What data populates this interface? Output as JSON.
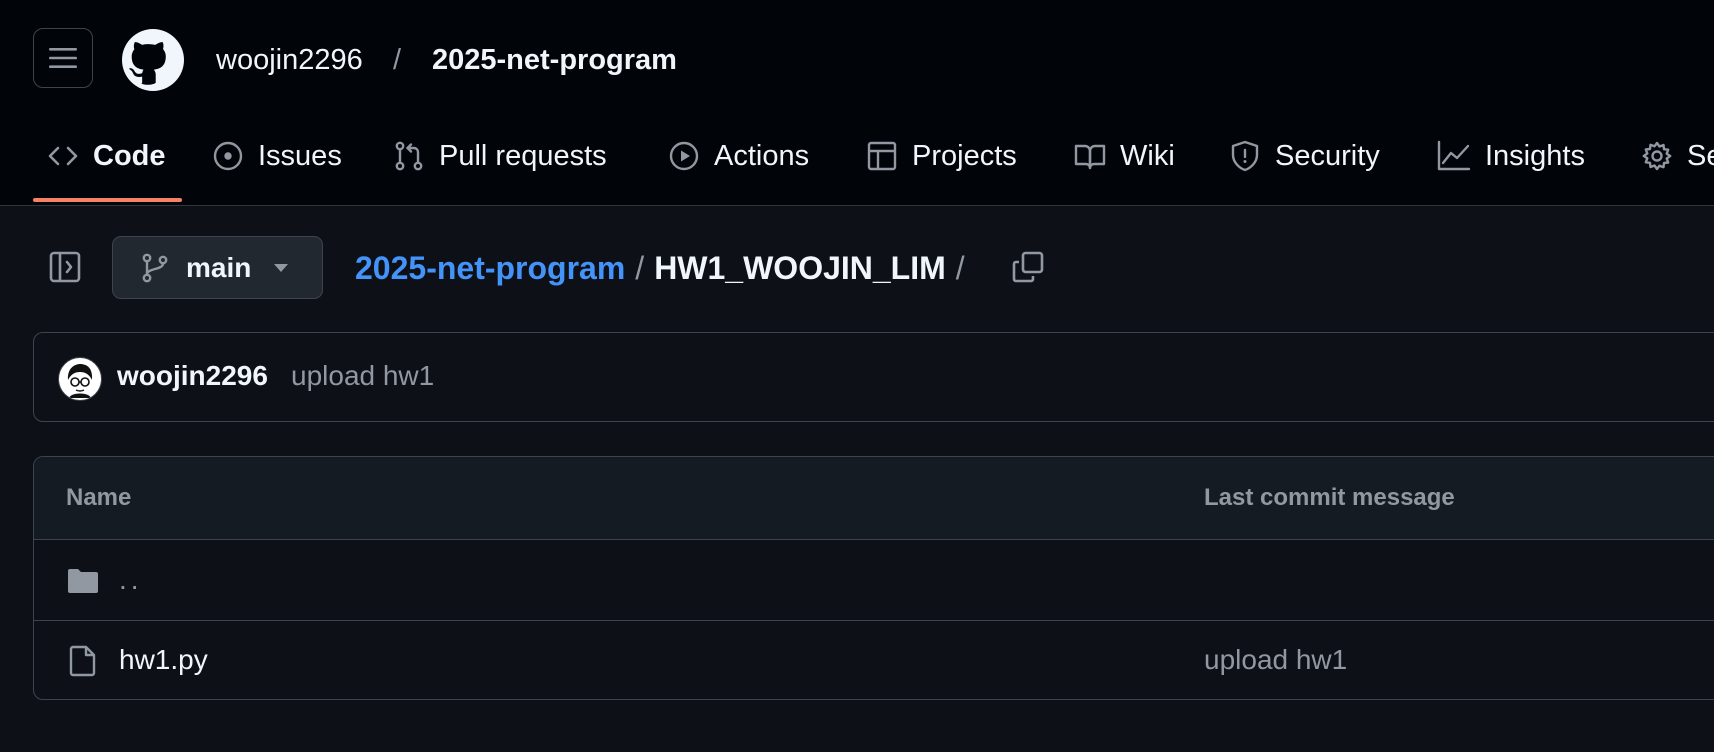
{
  "header": {
    "owner": "woojin2296",
    "separator": "/",
    "repo": "2025-net-program"
  },
  "tabs": [
    {
      "label": "Code",
      "icon": "code-icon",
      "active": true
    },
    {
      "label": "Issues",
      "icon": "issue-icon"
    },
    {
      "label": "Pull requests",
      "icon": "pull-request-icon"
    },
    {
      "label": "Actions",
      "icon": "play-icon"
    },
    {
      "label": "Projects",
      "icon": "table-icon"
    },
    {
      "label": "Wiki",
      "icon": "book-icon"
    },
    {
      "label": "Security",
      "icon": "shield-icon"
    },
    {
      "label": "Insights",
      "icon": "graph-icon"
    },
    {
      "label": "Se",
      "icon": "gear-icon"
    }
  ],
  "branch": {
    "name": "main"
  },
  "breadcrumb": {
    "repo_link": "2025-net-program",
    "sep1": "/",
    "current": "HW1_WOOJIN_LIM",
    "sep2": "/"
  },
  "latest_commit": {
    "author": "woojin2296",
    "message": "upload hw1"
  },
  "file_table": {
    "col_name": "Name",
    "col_last_commit": "Last commit message",
    "rows": [
      {
        "name": "..",
        "icon": "folder-icon",
        "message": ""
      },
      {
        "name": "hw1.py",
        "icon": "file-icon",
        "message": "upload hw1"
      }
    ]
  },
  "colors": {
    "accent_link": "#4493f8",
    "tab_underline": "#f78166",
    "background": "#0d1117",
    "header_bg": "#010409"
  }
}
